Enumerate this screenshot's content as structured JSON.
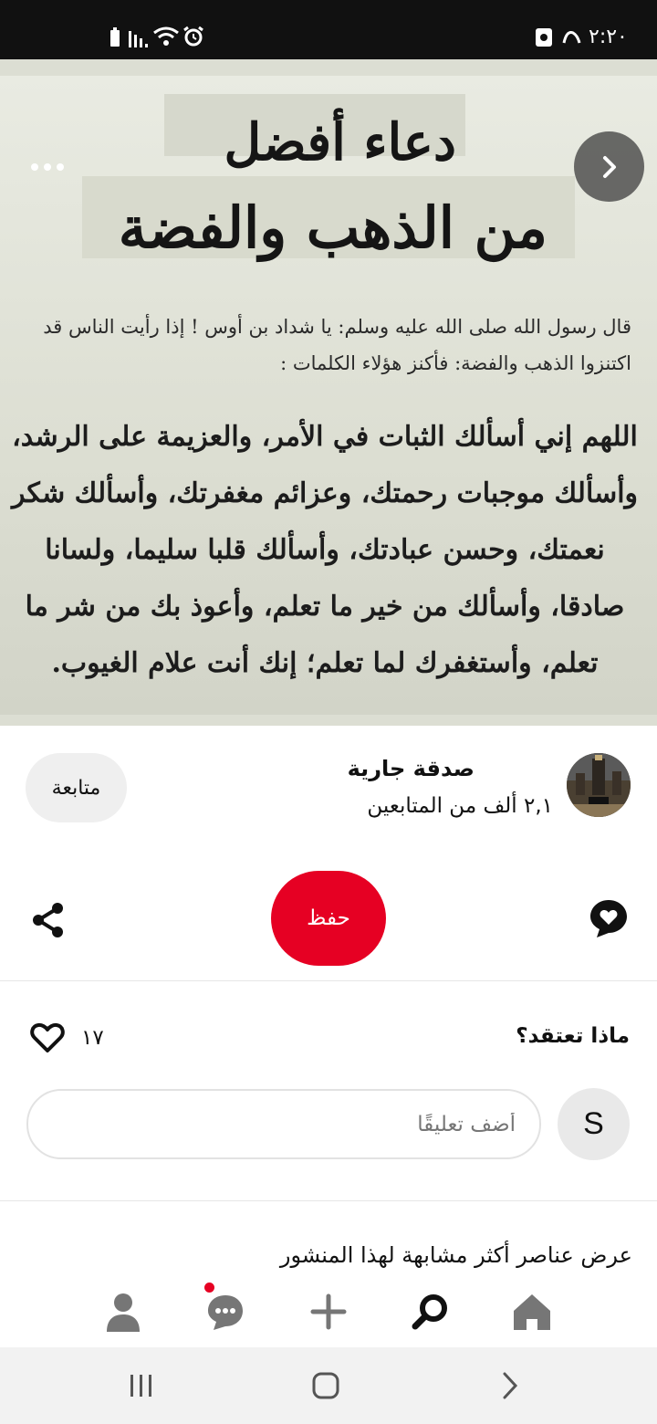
{
  "status_bar": {
    "time": "٢:٢٠"
  },
  "post_image": {
    "title_line1": "دعاء أفضل",
    "title_line2": "من الذهب والفضة",
    "hadith_text": "قال رسول الله صلى الله عليه وسلم: يا شداد بن أوس ! إذا رأيت الناس قد اكتنزوا الذهب والفضة: فأكنز هؤلاء الكلمات :",
    "dua_text": "اللهم إني أسألك الثبات في الأمر، والعزيمة على الرشد، وأسألك موجبات رحمتك، وعزائم مغفرتك، وأسألك شكر نعمتك، وحسن عبادتك، وأسألك قلبا سليما، ولسانا صادقا، وأسألك من خير ما تعلم، وأعوذ بك من شر ما تعلم، وأستغفرك لما تعلم؛ إنك أنت علام الغيوب."
  },
  "creator": {
    "name": "صدقة جارية",
    "followers": "٢,١ ألف من المتابعين",
    "follow_label": "متابعة"
  },
  "actions": {
    "save_label": "حفظ"
  },
  "comments": {
    "title": "ماذا تعتقد؟",
    "like_count": "١٧",
    "user_initial": "S",
    "input_placeholder": "أضف تعليقًا"
  },
  "more_like_this": "عرض عناصر أكثر مشابهة لهذا المنشور",
  "icons": {
    "more": "more-icon",
    "next": "chevron-right-icon",
    "share": "share-icon",
    "reaction": "heart-speech-icon",
    "like": "heart-icon",
    "home": "home-icon",
    "search": "search-icon",
    "create": "plus-icon",
    "messages": "chat-icon",
    "profile": "profile-icon"
  },
  "colors": {
    "accent": "#e60023",
    "status_bar": "#111111"
  }
}
